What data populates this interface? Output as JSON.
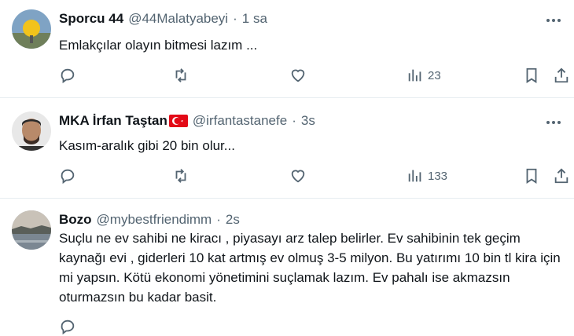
{
  "tweets": [
    {
      "name": "Sporcu 44",
      "handle": "@44Malatyabeyi",
      "sep": "·",
      "time": "1 sa",
      "text": "Emlakçılar olayın bitmesi lazım ...",
      "views": "23"
    },
    {
      "name": "MKA İrfan Taştan",
      "handle": "@irfantastanefe",
      "sep": "·",
      "time": "3s",
      "text": "Kasım-aralık gibi 20 bin olur...",
      "views": "133"
    },
    {
      "name": "Bozo",
      "handle": "@mybestfriendimm",
      "sep": "·",
      "time": "2s",
      "text": "Suçlu ne ev sahibi ne kiracı , piyasayı arz talep belirler. Ev sahibinin tek geçim kaynağı evi , giderleri 10 kat artmış ev olmuş 3-5 milyon. Bu yatırımı 10 bin tl kira için mi yapsın. Kötü ekonomi yönetimini suçlamak lazım. Ev pahalı ise akmazsın oturmazsın bu kadar basit."
    }
  ],
  "icons": [
    "reply-icon",
    "retweet-icon",
    "like-icon",
    "views-icon",
    "bookmark-icon",
    "share-icon",
    "more-icon"
  ],
  "colors": {
    "text": "#0f1419",
    "secondary": "#536471",
    "divider": "#e6ecf0",
    "flag": "#e30a17"
  }
}
